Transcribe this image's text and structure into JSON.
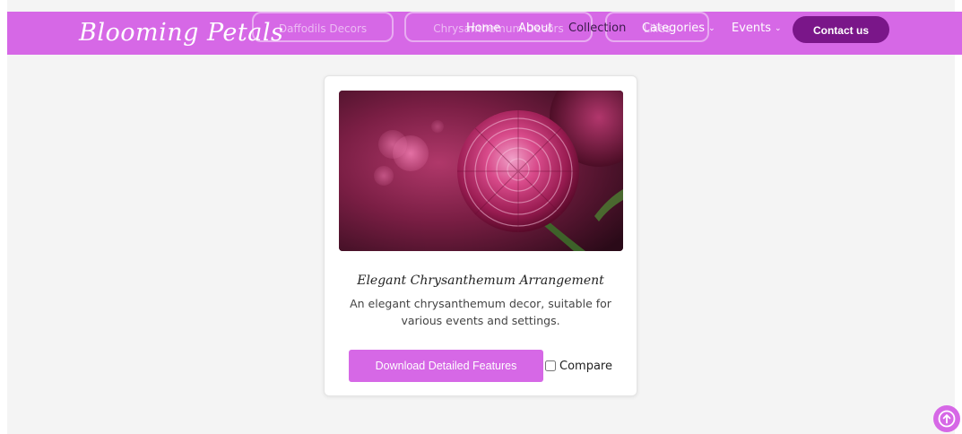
{
  "navbar": {
    "brand": "Blooming Petals",
    "ghost_items": [
      "Daffodils Decors",
      "Chrysanthemum Decors",
      "Lilies"
    ],
    "links": {
      "home": "Home",
      "about": "About",
      "collection": "Collection",
      "categories": "Categories",
      "events": "Events"
    },
    "caret": "⌄",
    "contact_label": "Contact us"
  },
  "card": {
    "title": "Elegant Chrysanthemum Arrangement",
    "description": "An elegant chrysanthemum decor, suitable for various events and settings.",
    "download_label": "Download Detailed Features",
    "compare_label": "Compare",
    "compare_checked": false
  },
  "icons": {
    "scroll_top": "arrow-up-circle-icon"
  },
  "colors": {
    "navbar_bg": "#d668e6",
    "brand_text": "#ffffff",
    "contact_bg": "#7a1689",
    "button_bg": "#d668e6",
    "page_bg": "#f4f4f4",
    "card_bg": "#ffffff"
  }
}
